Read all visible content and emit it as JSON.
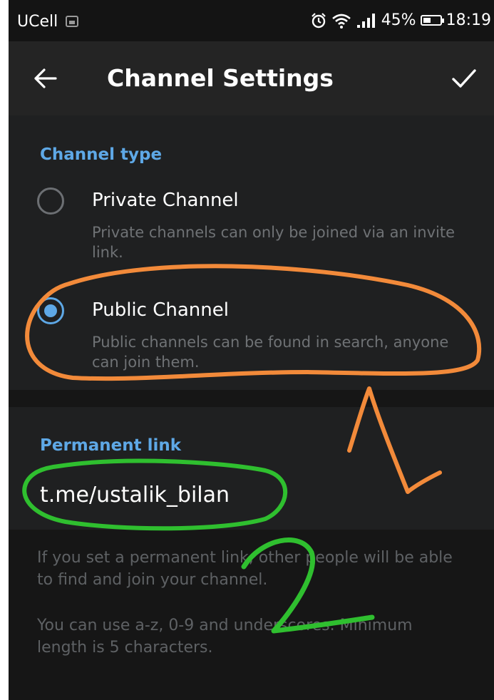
{
  "status_bar": {
    "carrier": "UCell",
    "battery_percent": "45%",
    "battery_level": 0.45,
    "time": "18:19",
    "icons": [
      "gallery-icon",
      "alarm-icon",
      "wifi-icon",
      "signal-icon",
      "battery-icon"
    ]
  },
  "app_bar": {
    "title": "Channel Settings",
    "back_icon": "arrow-left-icon",
    "confirm_icon": "check-icon"
  },
  "channel_type": {
    "header": "Channel type",
    "options": [
      {
        "title": "Private Channel",
        "description": "Private channels can only be joined via an invite link.",
        "selected": false
      },
      {
        "title": "Public Channel",
        "description": "Public channels can be found in search, anyone can join them.",
        "selected": true
      }
    ]
  },
  "permanent_link": {
    "header": "Permanent link",
    "value": "t.me/ustalik_bilan"
  },
  "info": {
    "paragraph1": "If you set a permanent link, other people will be able to find and join your channel.",
    "paragraph2": "You can use a-z, 0-9 and underscores. Minimum length is 5 characters."
  },
  "annotations": {
    "handwritten_number": "2",
    "colors": {
      "orange": "#f28a3a",
      "green": "#2fbf2f"
    }
  },
  "colors": {
    "accent": "#5ea8e6",
    "background": "#1d1d1d",
    "app_bar": "#242424",
    "secondary_text": "#6f7275"
  }
}
